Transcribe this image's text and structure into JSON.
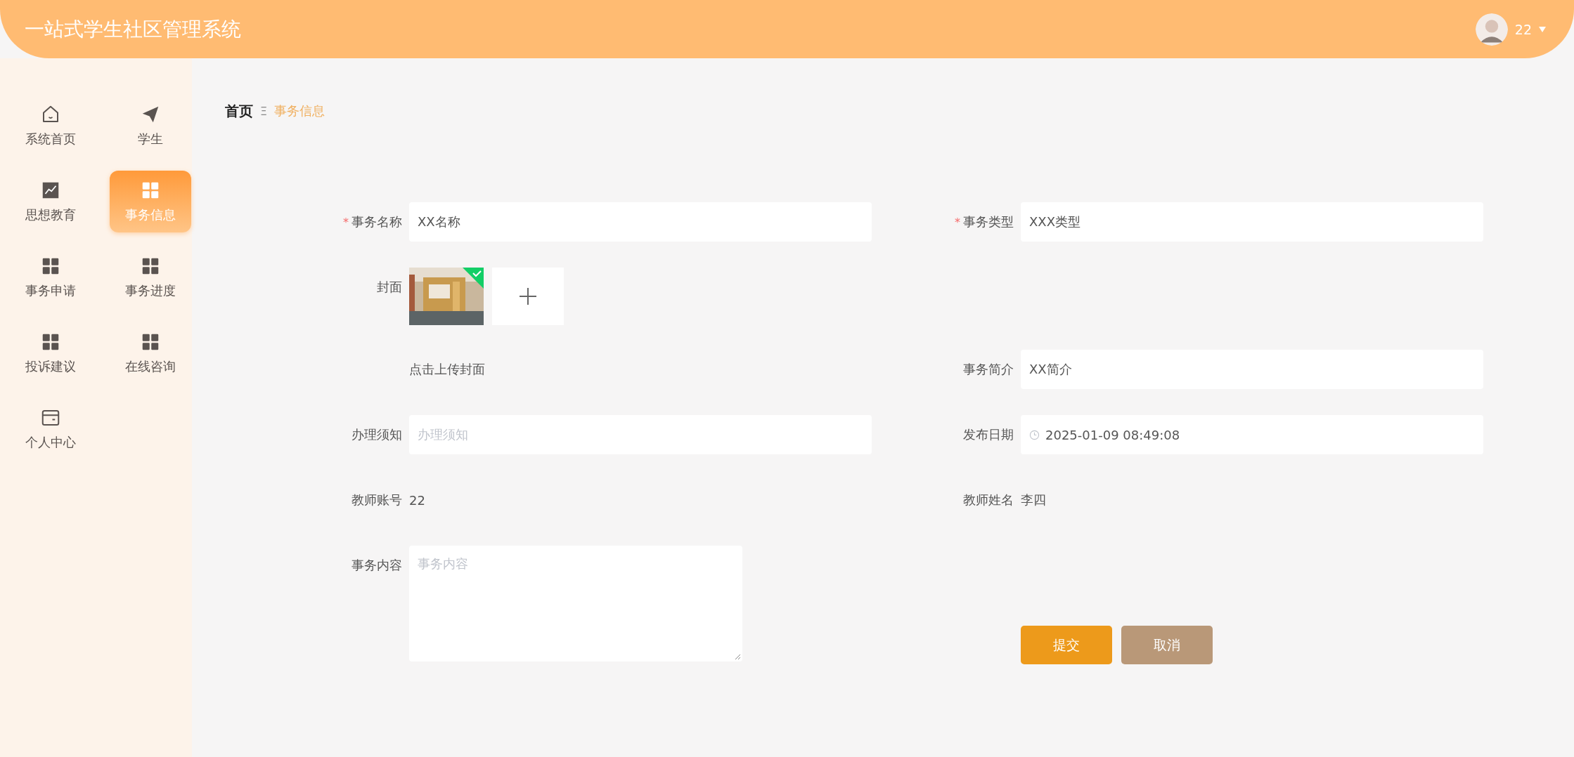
{
  "header": {
    "title": "一站式学生社区管理系统",
    "user": "22"
  },
  "sidebar": {
    "items": [
      {
        "label": "系统首页",
        "selected": false
      },
      {
        "label": "学生",
        "selected": false
      },
      {
        "label": "思想教育",
        "selected": false
      },
      {
        "label": "事务信息",
        "selected": true
      },
      {
        "label": "事务申请",
        "selected": false
      },
      {
        "label": "事务进度",
        "selected": false
      },
      {
        "label": "投诉建议",
        "selected": false
      },
      {
        "label": "在线咨询",
        "selected": false
      },
      {
        "label": "个人中心",
        "selected": false
      }
    ]
  },
  "breadcrumb": {
    "home": "首页",
    "separator": "Ξ",
    "current": "事务信息"
  },
  "form": {
    "rows": [
      {
        "left": {
          "kind": "input",
          "required_mark": "*",
          "label": "事务名称",
          "value": "XX名称"
        },
        "right": {
          "kind": "input",
          "required_mark": "*",
          "label": "事务类型",
          "value": "XXX类型"
        }
      },
      {
        "left": {
          "kind": "upload",
          "label": "封面"
        }
      },
      {
        "left": {
          "kind": "text",
          "value": "点击上传封面"
        },
        "right": {
          "kind": "input",
          "label": "事务简介",
          "value": "XX简介"
        }
      },
      {
        "left": {
          "kind": "input",
          "label": "办理须知",
          "placeholder": "办理须知"
        },
        "right": {
          "kind": "datetime",
          "label": "发布日期",
          "value": "2025-01-09 08:49:08"
        }
      },
      {
        "left": {
          "kind": "text",
          "label": "教师账号",
          "value": "22"
        },
        "right": {
          "kind": "text",
          "label": "教师姓名",
          "value": "李四"
        }
      },
      {
        "left": {
          "kind": "textarea",
          "label": "事务内容",
          "placeholder": "事务内容"
        }
      }
    ],
    "buttons": [
      {
        "label": "提交",
        "kind": "primary"
      },
      {
        "label": "取消",
        "kind": "secondary"
      }
    ]
  }
}
